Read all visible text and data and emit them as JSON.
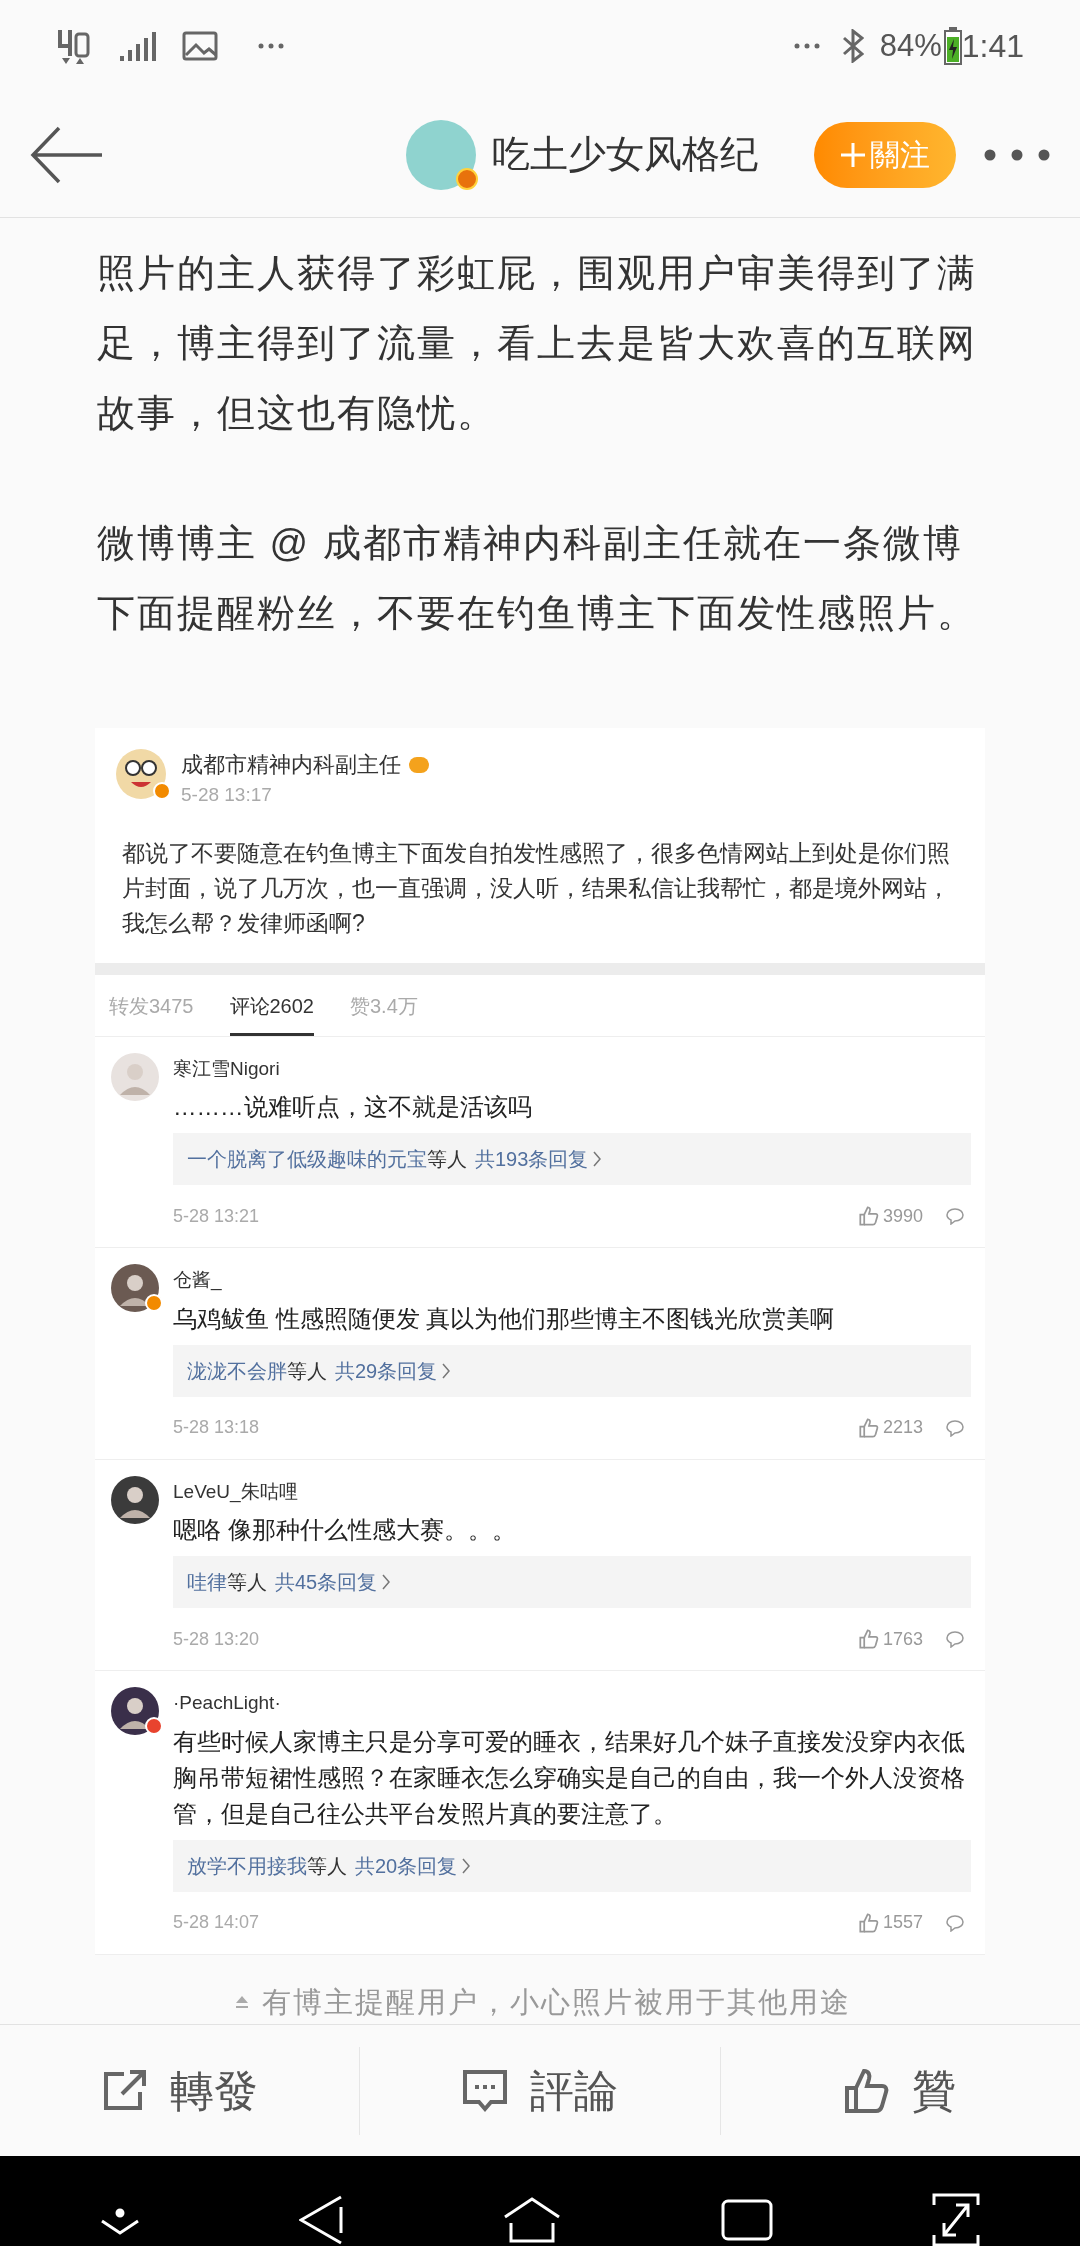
{
  "status_bar": {
    "battery": "84%",
    "time": "1:41"
  },
  "header": {
    "title": "吃土少女风格纪",
    "follow_button": "關注"
  },
  "article": {
    "paragraphs": [
      "照片的主人获得了彩虹屁，围观用户审美得到了满足，博主得到了流量，看上去是皆大欢喜的互联网故事，但这也有隐忧。",
      "微博博主 @ 成都市精神内科副主任就在一条微博下面提醒粉丝，不要在钓鱼博主下面发性感照片。"
    ]
  },
  "embedded_post": {
    "author": "成都市精神内科副主任",
    "time": "5-28 13:17",
    "body": "都说了不要随意在钓鱼博主下面发自拍发性感照了，很多色情网站上到处是你们照片封面，说了几万次，也一直强调，没人听，结果私信让我帮忙，都是境外网站，我怎么帮？发律师函啊?",
    "tabs": [
      {
        "label": "转发3475",
        "selected": false
      },
      {
        "label": "评论2602",
        "selected": true
      },
      {
        "label": "赞3.4万",
        "selected": false
      }
    ],
    "comments": [
      {
        "name": "寒江雪Nigori",
        "verified": false,
        "text": "………说难听点，这不就是活该吗",
        "replier": "一个脱离了低级趣味的元宝",
        "replier_suffix": "等人",
        "reply_count": "共193条回复",
        "time": "5-28 13:21",
        "likes": "3990"
      },
      {
        "name": "仓酱_",
        "verified": true,
        "color": "#f28a00",
        "text": "乌鸡鲅鱼 性感照随便发 真以为他们那些博主不图钱光欣赏美啊",
        "replier": "泷泷不会胖",
        "replier_suffix": "等人",
        "reply_count": "共29条回复",
        "time": "5-28 13:18",
        "likes": "2213"
      },
      {
        "name": "LeVeU_朱咕哩",
        "verified": false,
        "text": "嗯咯 像那种什么性感大赛。。。",
        "replier": "哇律",
        "replier_suffix": "等人",
        "reply_count": "共45条回复",
        "time": "5-28 13:20",
        "likes": "1763"
      },
      {
        "name": "·PeachLight·",
        "verified": true,
        "color": "#e8432e",
        "text": "有些时候人家博主只是分享可爱的睡衣，结果好几个妹子直接发没穿内衣低胸吊带短裙性感照？在家睡衣怎么穿确实是自己的自由，我一个外人没资格管，但是自己往公共平台发照片真的要注意了。",
        "replier": "放学不用接我",
        "replier_suffix": "等人",
        "reply_count": "共20条回复",
        "time": "5-28 14:07",
        "likes": "1557"
      }
    ]
  },
  "caption": "有博主提醒用户，小心照片被用于其他用途",
  "action_bar": [
    {
      "kind": "repost",
      "label": "轉發"
    },
    {
      "kind": "comment",
      "label": "評論"
    },
    {
      "kind": "like",
      "label": "贊"
    }
  ]
}
